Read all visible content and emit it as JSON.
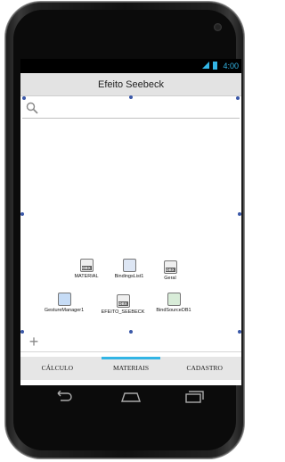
{
  "status_bar": {
    "time": "4:00"
  },
  "title_bar": {
    "title": "Efeito Seebeck"
  },
  "search": {
    "icon": "search-icon"
  },
  "components": [
    {
      "label": "MATERIAL",
      "badge": "DBX"
    },
    {
      "label": "BindingsList1",
      "badge": ""
    },
    {
      "label": "Geral",
      "badge": "DBX"
    },
    {
      "label": "GestureManager1",
      "badge": ""
    },
    {
      "label": "EFEITO_SEEBECK",
      "badge": "DBX"
    },
    {
      "label": "BindSourceDB1",
      "badge": ""
    }
  ],
  "add_button": {
    "label": "+"
  },
  "tabs": [
    {
      "label": "CÁLCULO",
      "active": false
    },
    {
      "label": "MATERIAIS",
      "active": true
    },
    {
      "label": "CADASTRO",
      "active": false
    }
  ],
  "colors": {
    "accent": "#33b5e5",
    "handle": "#3a58a8",
    "title_bar_bg": "#e3e3e3"
  }
}
